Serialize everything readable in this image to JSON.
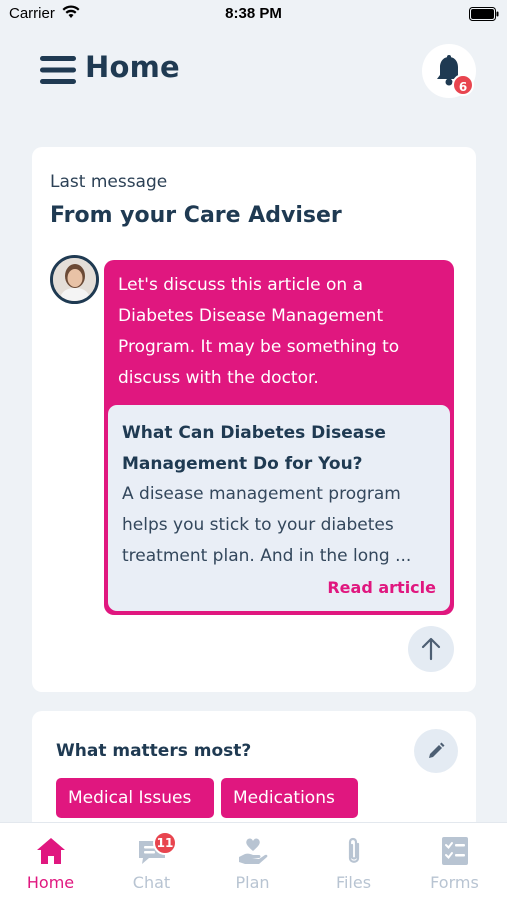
{
  "status_bar": {
    "carrier": "Carrier",
    "time": "8:38 PM"
  },
  "header": {
    "title": "Home",
    "notifications_count": "6"
  },
  "message_card": {
    "label": "Last message",
    "title": "From your Care Adviser",
    "message": "Let's discuss this article on a Diabetes Disease Management Program. It may be something to discuss with the doctor.",
    "article": {
      "title": "What Can Diabetes Disease Management Do for You?",
      "excerpt": "A disease management program helps you stick to your diabetes treatment plan. And in the long ...",
      "link_label": "Read article"
    }
  },
  "matters_card": {
    "title": "What matters most?",
    "tags": [
      "Medical Issues",
      "Medications"
    ]
  },
  "tab_bar": {
    "tabs": [
      {
        "label": "Home",
        "icon": "home-icon",
        "active": true
      },
      {
        "label": "Chat",
        "icon": "chat-icon",
        "badge": "11"
      },
      {
        "label": "Plan",
        "icon": "plan-icon"
      },
      {
        "label": "Files",
        "icon": "paperclip-icon"
      },
      {
        "label": "Forms",
        "icon": "checklist-icon"
      }
    ]
  },
  "colors": {
    "accent": "#e0177f",
    "navy": "#1f3a52",
    "badge": "#e8454f",
    "background": "#eef2f6",
    "inactive_tab": "#b8c4d2"
  }
}
